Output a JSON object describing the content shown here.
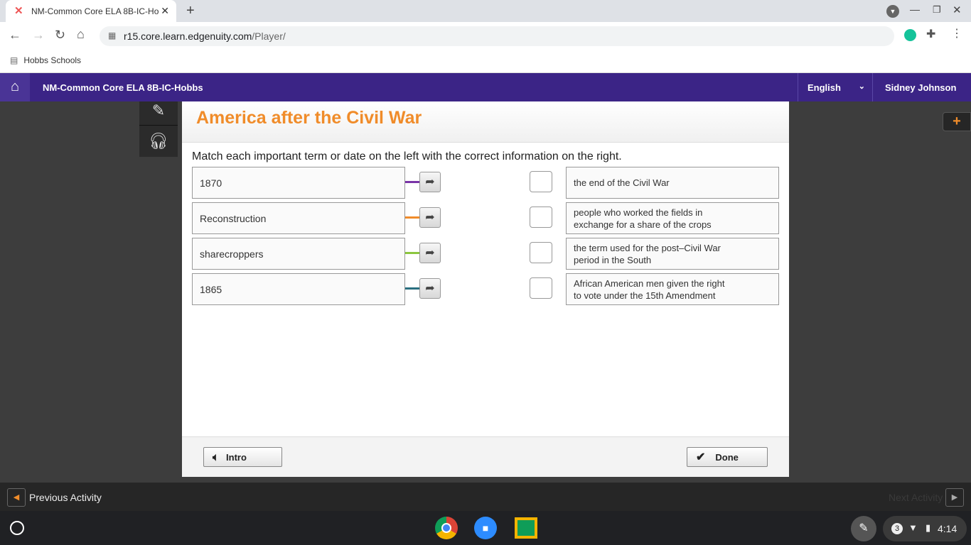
{
  "browser": {
    "tab_title": "NM-Common Core ELA 8B-IC-Ho",
    "url_host": "r15.core.learn.edgenuity.com",
    "url_path": "/Player/",
    "bookmark": "Hobbs Schools"
  },
  "navbar": {
    "course": "NM-Common Core ELA 8B-IC-Hobbs",
    "language": "English",
    "user": "Sidney Johnson"
  },
  "activity": {
    "title": "America after the Civil War",
    "instructions": "Match each important term or date on the left with the correct information on the right.",
    "terms": [
      {
        "label": "1870",
        "color": "#7a35a8"
      },
      {
        "label": "Reconstruction",
        "color": "#f08c2a"
      },
      {
        "label": "sharecroppers",
        "color": "#8cc63f"
      },
      {
        "label": "1865",
        "color": "#2a6f80"
      }
    ],
    "definitions": [
      {
        "line1": "the end of the Civil War",
        "line2": ""
      },
      {
        "line1": "people who worked the fields in",
        "line2": "exchange for a share of the crops"
      },
      {
        "line1": "the term used for the post–Civil War",
        "line2": "period in the South"
      },
      {
        "line1": "African American men given the right",
        "line2": "to vote under the 15th Amendment"
      }
    ],
    "intro_label": "Intro",
    "done_label": "Done"
  },
  "bottom": {
    "previous": "Previous Activity",
    "next": "Next Activity"
  },
  "shelf": {
    "notifications": "3",
    "time": "4:14"
  }
}
